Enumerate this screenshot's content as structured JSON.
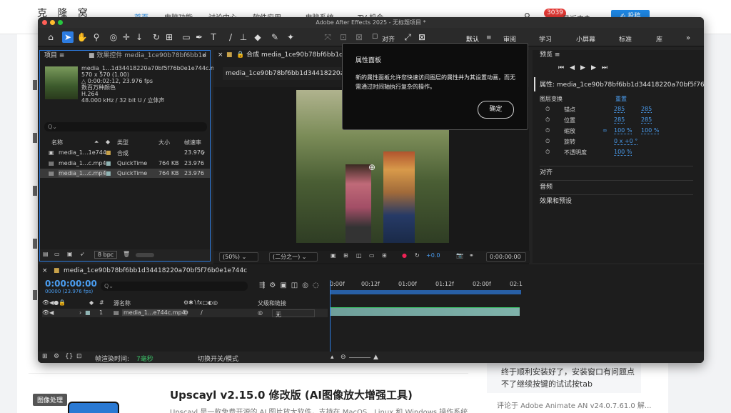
{
  "website": {
    "logo": "克 隆 窝",
    "nav": [
      "首页",
      "电脑功能",
      "讨论中心",
      "软件应用 ⌄",
      "电脑系统 ⌄",
      "TV 机会"
    ],
    "badge": "3039",
    "user": "最近中办 ⌄",
    "post_button": "✍ 投稿",
    "comment_text": "终于顺利安装好了，安装窗口有问题点不了继续按键的试试按tab",
    "comment_meta": "评论于 Adobe Animate AN v24.0.7.61.0 解...",
    "category": "图像处理",
    "post_title": "Upscayl v2.15.0 修改版 (AI图像放大增强工具)",
    "post_desc": "Upscayl 是一款免费开源的 AI 图片放大软件，支持在 MacOS、Linux 和 Windows 操作系统"
  },
  "app": {
    "title": "Adobe After Effects 2025 - 无标题项目 *",
    "toolbar": {
      "align_label": "对齐",
      "workspaces": [
        "默认",
        "审阅",
        "学习",
        "小屏幕",
        "标准",
        "库"
      ]
    },
    "project": {
      "tab": "项目",
      "effects_tab": "效果控件 media_1ce90b78bf6bb1d",
      "file_name": "media_1...1d34418220a70bf5f76b0e1e744c.mp4",
      "info": [
        "570 x 570 (1.00)",
        "△ 0:00:02:12, 23.976 fps",
        "数百万种颜色",
        "H.264",
        "48.000 kHz / 32 bit U / 立体声"
      ],
      "search_placeholder": "Q⌄",
      "columns": [
        "名称",
        "类型",
        "大小",
        "帧速率"
      ],
      "rows": [
        {
          "name": "media_1...1e744c",
          "type": "合成",
          "size": "",
          "fps": "23.976"
        },
        {
          "name": "media_1...c.mp4",
          "type": "QuickTime",
          "size": "764 KB",
          "fps": "23.976"
        },
        {
          "name": "media_1...c.mp4",
          "type": "QuickTime",
          "size": "764 KB",
          "fps": "23.976"
        }
      ],
      "bpc": "8 bpc"
    },
    "comp": {
      "tab": "合成 media_1ce90b78bf6bb1d34418220a70b",
      "subtab": "media_1ce90b78bf6bb1d34418220a70b",
      "zoom": "(50%)",
      "resolution": "(二分之一)",
      "exposure": "+0.0",
      "timecode": "0:00:00:00"
    },
    "tooltip": {
      "title": "属性面板",
      "body": "新的属性面板允许您快速访问图层的属性并为其设置动画，而无需通过时间轴执行复杂的操作。",
      "button": "确定"
    },
    "right": {
      "preview_tab": "预览",
      "properties_title": "属性: media_1ce90b78bf6bb1d34418220a70bf5f76",
      "transform": "图层变换",
      "reset": "重置",
      "props": [
        {
          "label": "锚点",
          "v1": "285",
          "v2": "285"
        },
        {
          "label": "位置",
          "v1": "285",
          "v2": "285"
        },
        {
          "label": "缩放",
          "v1": "100 %",
          "v2": "100 %"
        },
        {
          "label": "旋转",
          "v1": "0 x +0 °",
          "v2": ""
        },
        {
          "label": "不透明度",
          "v1": "100 %",
          "v2": ""
        }
      ],
      "sections": [
        "对齐",
        "音频",
        "效果和预设"
      ]
    },
    "timeline": {
      "tab": "media_1ce90b78bf6bb1d34418220a70bf5f76b0e1e744c",
      "timecode": "0:00:00:00",
      "fps_note": "00000 (23.976 fps)",
      "cols": [
        "#",
        "源名称",
        "父级和链接"
      ],
      "layer_num": "1",
      "layer_name": "media_1...e744c.mp4",
      "parent": "无",
      "ruler": [
        "0:00f",
        "00:12f",
        "01:00f",
        "01:12f",
        "02:00f",
        "02:1"
      ],
      "render_label": "帧渲染时间:",
      "render_value": "7毫秒",
      "switch_label": "切换开关/模式"
    }
  }
}
